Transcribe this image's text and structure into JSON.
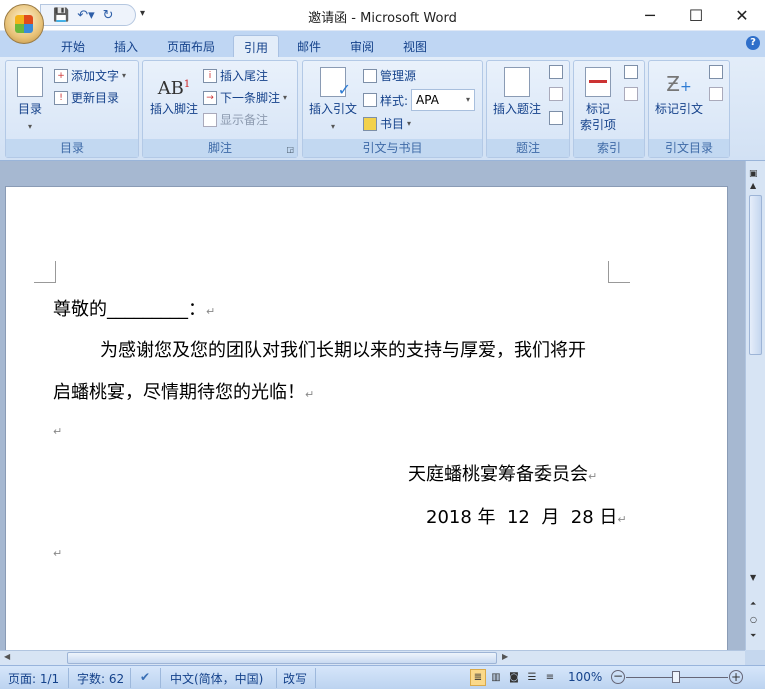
{
  "window": {
    "title": "邀请函 - Microsoft Word"
  },
  "tabs": [
    "开始",
    "插入",
    "页面布局",
    "引用",
    "邮件",
    "审阅",
    "视图"
  ],
  "active_tab": "引用",
  "ribbon": {
    "toc": {
      "label": "目录",
      "add_text": "添加文字",
      "update": "更新目录",
      "group": "目录"
    },
    "footnotes": {
      "insert_footnote": "插入脚注",
      "footnote_icon": "AB",
      "footnote_sup": "1",
      "insert_endnote": "插入尾注",
      "next_footnote": "下一条脚注",
      "show_notes": "显示备注",
      "group": "脚注"
    },
    "citations": {
      "insert_citation": "插入引文",
      "manage_sources": "管理源",
      "style_label": "样式:",
      "style_value": "APA",
      "bibliography": "书目",
      "group": "引文与书目"
    },
    "captions": {
      "insert_caption": "插入题注",
      "group": "题注"
    },
    "index": {
      "mark_entry_1": "标记",
      "mark_entry_2": "索引项",
      "group": "索引"
    },
    "toa": {
      "mark_citation": "标记引文",
      "group": "引文目录"
    }
  },
  "document": {
    "salutation": "尊敬的_________：",
    "body_line1": "为感谢您及您的团队对我们长期以来的支持与厚爱，我们将开",
    "body_line2": "启蟠桃宴，尽情期待您的光临！",
    "signature": "天庭蟠桃宴筹备委员会",
    "date": "2018 年  12  月  28 日",
    "para_mark": "↵"
  },
  "status": {
    "page": "页面: 1/1",
    "words": "字数: 62",
    "language": "中文(简体，中国)",
    "mode": "改写",
    "zoom": "100%",
    "zoom_percent": 100
  }
}
